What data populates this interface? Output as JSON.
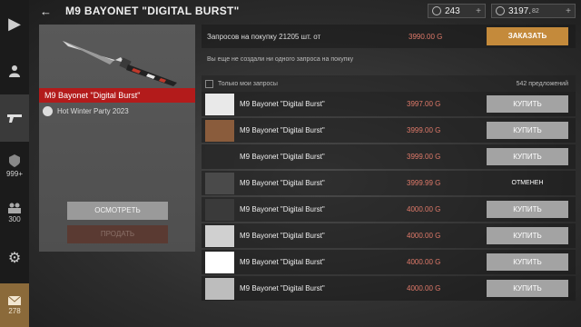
{
  "header": {
    "back_icon": "arrow-left-icon",
    "title": "M9 BAYONET \"DIGITAL BURST\"",
    "currency1": "243",
    "currency2_main": "3197.",
    "currency2_small": "82"
  },
  "sidebar": {
    "rank_count": "999+",
    "clan_count": "300",
    "mail_count": "278"
  },
  "item": {
    "name": "M9 Bayonet \"Digital Burst\"",
    "collection": "Hot Winter Party 2023",
    "inspect_label": "ОСМОТРЕТЬ",
    "sell_label": "ПРОДАТЬ"
  },
  "requests": {
    "summary": "Запросов на покупку 21205 шт. от",
    "price": "3990.00 G",
    "order_label": "ЗАКАЗАТЬ",
    "none_text": "Вы еще не создали ни одного запроса на покупку"
  },
  "filter": {
    "label": "Только мои запросы",
    "offers": "542 предложений"
  },
  "offers": [
    {
      "name": "M9 Bayonet \"Digital Burst\"",
      "price": "3997.00 G",
      "action": "КУПИТЬ",
      "cancelled": false
    },
    {
      "name": "M9 Bayonet \"Digital Burst\"",
      "price": "3999.00 G",
      "action": "КУПИТЬ",
      "cancelled": false
    },
    {
      "name": "M9 Bayonet \"Digital Burst\"",
      "price": "3999.00 G",
      "action": "КУПИТЬ",
      "cancelled": false
    },
    {
      "name": "M9 Bayonet \"Digital Burst\"",
      "price": "3999.99 G",
      "action": "ОТМЕНЕН",
      "cancelled": true
    },
    {
      "name": "M9 Bayonet \"Digital Burst\"",
      "price": "4000.00 G",
      "action": "КУПИТЬ",
      "cancelled": false
    },
    {
      "name": "M9 Bayonet \"Digital Burst\"",
      "price": "4000.00 G",
      "action": "КУПИТЬ",
      "cancelled": false
    },
    {
      "name": "M9 Bayonet \"Digital Burst\"",
      "price": "4000.00 G",
      "action": "КУПИТЬ",
      "cancelled": false
    },
    {
      "name": "M9 Bayonet \"Digital Burst\"",
      "price": "4000.00 G",
      "action": "КУПИТЬ",
      "cancelled": false
    }
  ]
}
